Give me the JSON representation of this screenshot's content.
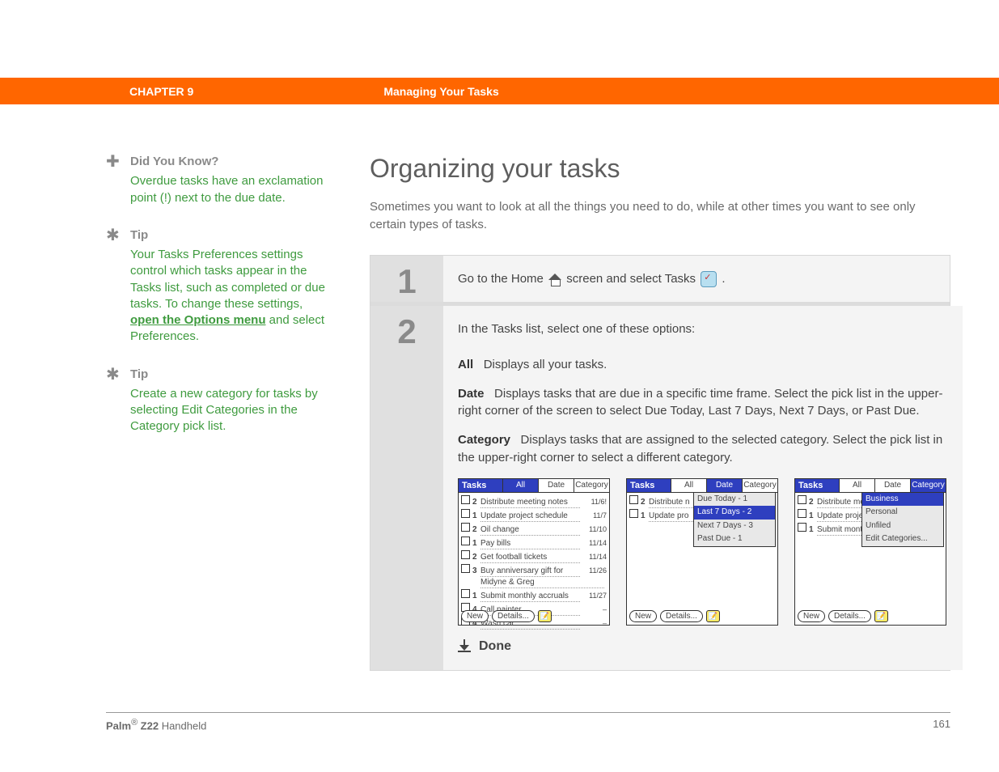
{
  "header": {
    "chapter": "CHAPTER 9",
    "title": "Managing Your Tasks"
  },
  "sidebar": {
    "didYouKnow": {
      "label": "Did You Know?",
      "body": "Overdue tasks have an exclamation point (!) next to the due date."
    },
    "tip1": {
      "label": "Tip",
      "body_pre": "Your Tasks Preferences settings control which tasks appear in the Tasks list, such as completed or due tasks. To change these settings, ",
      "link": "open the Options menu",
      "body_post": " and select Preferences."
    },
    "tip2": {
      "label": "Tip",
      "body": "Create a new category for tasks by selecting Edit Categories in the Category pick list."
    }
  },
  "main": {
    "heading": "Organizing your tasks",
    "intro": "Sometimes you want to look at all the things you need to do, while at other times you want to see only certain types of tasks.",
    "step1": {
      "num": "1",
      "text_a": "Go to the Home ",
      "text_b": " screen and select Tasks ",
      "text_c": "."
    },
    "step2": {
      "num": "2",
      "lead": "In the Tasks list, select one of these options:",
      "optAll": {
        "name": "All",
        "desc": "Displays all your tasks."
      },
      "optDate": {
        "name": "Date",
        "desc": "Displays tasks that are due in a specific time frame. Select the pick list in the upper-right corner of the screen to select Due Today, Last 7 Days, Next 7 Days, or Past Due."
      },
      "optCategory": {
        "name": "Category",
        "desc": "Displays tasks that are assigned to the selected category. Select the pick list in the upper-right corner to select a different category."
      },
      "done": "Done"
    }
  },
  "palm": {
    "title": "Tasks",
    "tabs": {
      "all": "All",
      "date": "Date",
      "category": "Category"
    },
    "buttons": {
      "new": "New",
      "details": "Details..."
    },
    "screenAll": [
      {
        "p": "2",
        "t": "Distribute meeting notes",
        "d": "11/6!"
      },
      {
        "p": "1",
        "t": "Update project schedule",
        "d": "11/7"
      },
      {
        "p": "2",
        "t": "Oil change",
        "d": "11/10"
      },
      {
        "p": "1",
        "t": "Pay bills",
        "d": "11/14"
      },
      {
        "p": "2",
        "t": "Get football tickets",
        "d": "11/14"
      },
      {
        "p": "3",
        "t": "Buy anniversary gift for",
        "d": "11/26"
      },
      {
        "sub": true,
        "t": "Midyne & Greg"
      },
      {
        "p": "1",
        "t": "Submit monthly accruals",
        "d": "11/27"
      },
      {
        "p": "4",
        "t": "Call painter",
        "d": "–"
      },
      {
        "p": "4",
        "t": "Wash car",
        "d": "–"
      }
    ],
    "screenDate": {
      "rows": [
        {
          "p": "2",
          "t": "Distribute n"
        },
        {
          "p": "1",
          "t": "Update pro"
        }
      ],
      "dropdown": [
        "Due Today - 1",
        "Last 7 Days - 2",
        "Next 7 Days - 3",
        "Past Due - 1"
      ]
    },
    "screenCat": {
      "rows": [
        {
          "p": "2",
          "t": "Distribute mee"
        },
        {
          "p": "1",
          "t": "Update projec"
        },
        {
          "p": "1",
          "t": "Submit monthl"
        }
      ],
      "dropdown": [
        "Business",
        "Personal",
        "Unfiled",
        "Edit Categories..."
      ]
    }
  },
  "footer": {
    "left_a": "Palm",
    "left_sup": "®",
    "left_b": " Z22",
    "left_c": " Handheld",
    "page": "161"
  }
}
